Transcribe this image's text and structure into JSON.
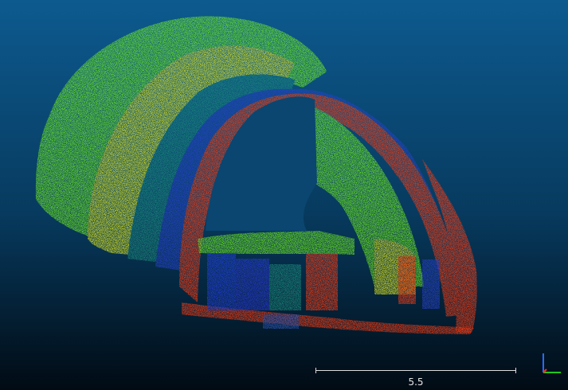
{
  "viewer": {
    "background_top": "#0d5a8f",
    "background_bottom": "#010b14",
    "scalar_colors": {
      "low": "#1f3fd8",
      "mid_low": "#1a8a7a",
      "mid": "#7cff1a",
      "mid_high": "#f5f51a",
      "high": "#ff3a10"
    }
  },
  "scale_bar": {
    "label": "5.5",
    "color": "#dcdcdc"
  },
  "axes": {
    "x_color": "#1ec81e",
    "y_color": "#2b6bff",
    "z_color": "#ff2a2a",
    "x_icon": "x-axis-arrow",
    "y_icon": "y-axis-arrow"
  }
}
